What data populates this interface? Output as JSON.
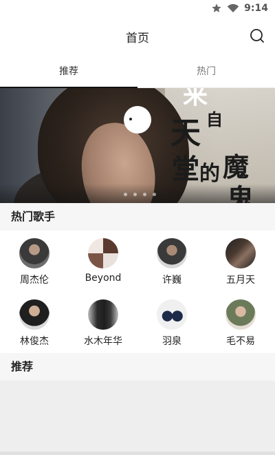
{
  "status_bar": {
    "time": "9:14",
    "icons": [
      "star-icon",
      "wifi-icon"
    ]
  },
  "app_bar": {
    "title": "首页",
    "search_icon": "search-icon"
  },
  "tabs": [
    {
      "label": "推荐",
      "active": true
    },
    {
      "label": "热门",
      "active": false
    }
  ],
  "banner": {
    "text_chars": [
      "来",
      "自",
      "天",
      "堂",
      "的",
      "魔",
      "鬼"
    ],
    "page_count": 4
  },
  "hot_singers": {
    "title": "热门歌手",
    "items": [
      {
        "name": "周杰伦",
        "avatar_colors": [
          "#2a2a2a",
          "#6d6d6d"
        ]
      },
      {
        "name": "Beyond",
        "avatar_colors": [
          "#5a3a2e",
          "#e9e2dc"
        ]
      },
      {
        "name": "许巍",
        "avatar_colors": [
          "#3a3a3a",
          "#d8d8d8"
        ]
      },
      {
        "name": "五月天",
        "avatar_colors": [
          "#222222",
          "#8a7060"
        ]
      },
      {
        "name": "林俊杰",
        "avatar_colors": [
          "#1f1f1f",
          "#d9d9d9"
        ]
      },
      {
        "name": "水木年华",
        "avatar_colors": [
          "#2b2b2b",
          "#bdbdbd"
        ]
      },
      {
        "name": "羽泉",
        "avatar_colors": [
          "#1e2a4a",
          "#f0f0f0"
        ]
      },
      {
        "name": "毛不易",
        "avatar_colors": [
          "#6b7b5a",
          "#e5ddd4"
        ]
      }
    ]
  },
  "recommend": {
    "title": "推荐"
  }
}
